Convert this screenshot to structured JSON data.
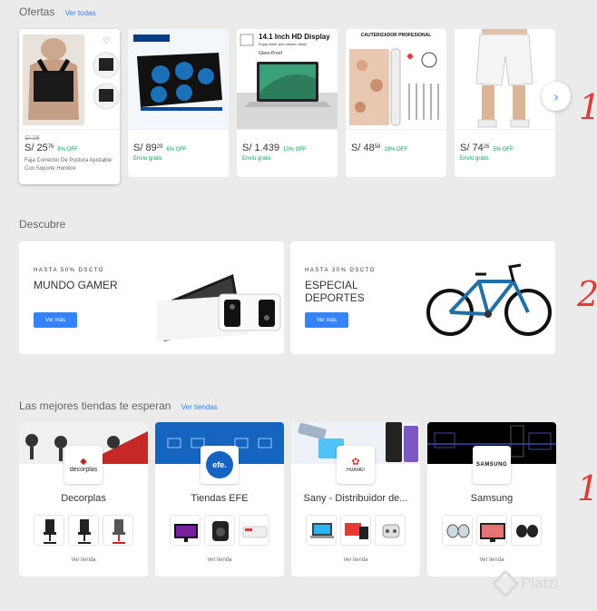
{
  "offers": {
    "title": "Ofertas",
    "link": "Ver todas",
    "items": [
      {
        "old_price": "S/ 28",
        "price": "S/ 25",
        "cents": "76",
        "discount": "8% OFF",
        "shipping": "",
        "title": "Faja Corrector De Postura Ajustable Con Soporte Hombre"
      },
      {
        "old_price": "",
        "price": "S/ 89",
        "cents": "29",
        "discount": "6% OFF",
        "shipping": "Envío gratis",
        "title": ""
      },
      {
        "old_price": "",
        "price": "S/ 1.439",
        "cents": "",
        "discount": "10% OFF",
        "shipping": "Envío gratis",
        "title": "",
        "img_heading": "14.1 Inch HD Display",
        "img_sub": "Enjoy wider and clearer views",
        "img_tag": "Glare-Proof"
      },
      {
        "old_price": "",
        "price": "S/ 48",
        "cents": "58",
        "discount": "18% OFF",
        "shipping": "",
        "title": "",
        "img_heading": "CAUTERIZADOR PROFESIONAL"
      },
      {
        "old_price": "",
        "price": "S/ 74",
        "cents": "26",
        "discount": "5% OFF",
        "shipping": "Envío gratis",
        "title": ""
      }
    ]
  },
  "discover": {
    "title": "Descubre",
    "cards": [
      {
        "eyebrow": "HASTA 50% DSCTO",
        "title": "MUNDO GAMER",
        "button": "Ver más"
      },
      {
        "eyebrow": "HASTA 30% DSCTO",
        "title": "ESPECIAL DEPORTES",
        "button": "Ver más"
      }
    ]
  },
  "stores": {
    "title": "Las mejores tiendas te esperan",
    "link": "Ver tiendas",
    "items": [
      {
        "name": "Decorplas",
        "logo": "decorplas",
        "link": "Ver tienda"
      },
      {
        "name": "Tiendas EFE",
        "logo": "efe.",
        "link": "Ver tienda"
      },
      {
        "name": "Sany - Distribuidor de...",
        "logo": "HUAWEI",
        "link": "Ver tienda"
      },
      {
        "name": "Samsung",
        "logo": "SAMSUNG",
        "link": "Ver tienda"
      }
    ]
  },
  "annotations": [
    "1",
    "2",
    "1"
  ],
  "watermark": "Platzi",
  "colors": {
    "accent": "#3483fa",
    "discount": "#00a650",
    "annotation": "#e53935"
  }
}
